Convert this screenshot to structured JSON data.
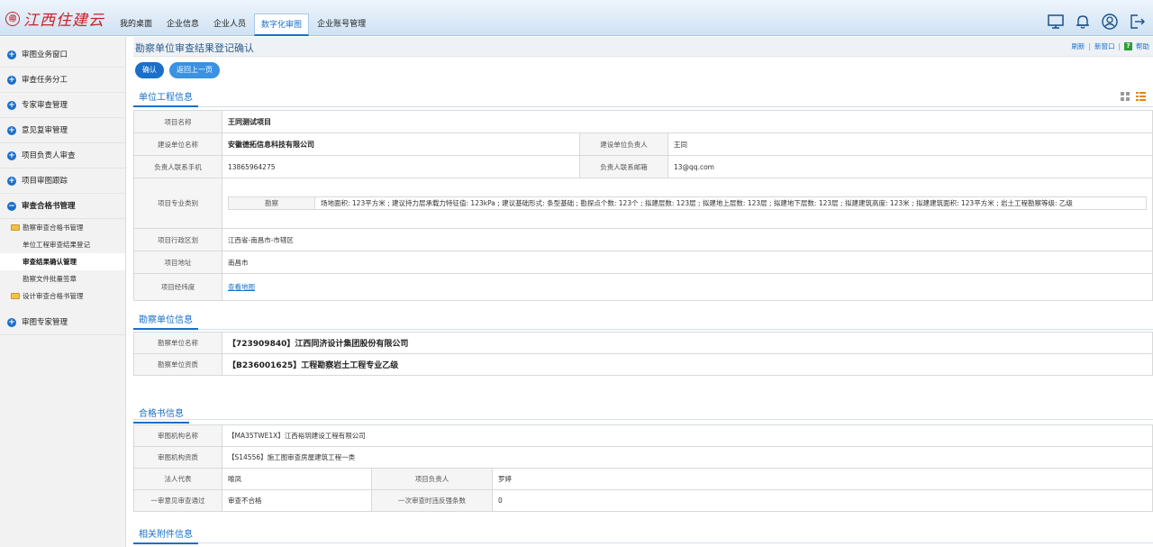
{
  "logo": {
    "seal": "㊞",
    "text": "江西住建云"
  },
  "nav": {
    "tabs": [
      {
        "label": "我的桌面"
      },
      {
        "label": "企业信息"
      },
      {
        "label": "企业人员"
      },
      {
        "label": "数字化审图",
        "active": true
      },
      {
        "label": "企业账号管理"
      }
    ]
  },
  "topicons": [
    "monitor-icon",
    "bell-icon",
    "user-icon",
    "logout-icon"
  ],
  "sidebar": {
    "items": [
      {
        "label": "审图业务窗口"
      },
      {
        "label": "审查任务分工"
      },
      {
        "label": "专家审查管理"
      },
      {
        "label": "意见复审管理"
      },
      {
        "label": "项目负责人审查"
      },
      {
        "label": "项目审图跟踪"
      },
      {
        "label": "审查合格书管理"
      },
      {
        "label": "审图专家管理"
      }
    ],
    "sub": {
      "folder1": "勘察审查合格书管理",
      "leaf1": "单位工程审查结果登记",
      "leaf2": "审查结果确认管理",
      "leaf3": "勘察文件批量签章",
      "folder2": "设计审查合格书管理"
    }
  },
  "page": {
    "title": "勘察单位审查结果登记确认",
    "links": {
      "refresh": "刷新",
      "sep": "|",
      "new_window": "新窗口",
      "help_q": "?",
      "help": "帮助"
    },
    "buttons": {
      "confirm": "确认",
      "back": "返回上一页"
    }
  },
  "project": {
    "section_title": "单位工程信息",
    "name_label": "项目名称",
    "name": "王同测试项目",
    "build_unit_label": "建设单位名称",
    "build_unit": "安徽德拓信息科技有限公司",
    "build_leader_label": "建设单位负责人",
    "build_leader": "王同",
    "phone_label": "负责人联系手机",
    "phone": "13865964275",
    "email_label": "负责人联系邮箱",
    "email": "13@qq.com",
    "category_label": "项目专业类别",
    "survey_label": "勘察",
    "survey_detail": "场地面积: 123平方米 ; 建议持力层承载力特征值: 123kPa ; 建议基础形式: 条型基础 ; 勘探点个数: 123个 ; 拟建层数: 123层 ; 拟建地上层数: 123层 ; 拟建地下层数: 123层 ; 拟建建筑高度: 123米 ; 拟建建筑面积: 123平方米 ; 岩土工程勘察等级: 乙级",
    "region_label": "项目行政区划",
    "region": "江西省-南昌市-市辖区",
    "address_label": "项目地址",
    "address": "南昌市",
    "geo_label": "项目经纬度",
    "geo_link": "查看地图"
  },
  "survey_unit": {
    "section_title": "勘察单位信息",
    "name_label": "勘察单位名称",
    "name": "【723909840】江西同济设计集团股份有限公司",
    "qual_label": "勘察单位资质",
    "qual": "【B236001625】工程勘察岩土工程专业乙级"
  },
  "certificate": {
    "section_title": "合格书信息",
    "org_label": "审图机构名称",
    "org": "【MA35TWE1X】江西裕玥建设工程有限公司",
    "org_qual_label": "审图机构资质",
    "org_qual": "【S14556】施工图审查房屋建筑工程一类",
    "legal_label": "法人代表",
    "legal": "喻凤",
    "leader_label": "项目负责人",
    "leader": "罗婷",
    "first_pass_label": "一审意见审查通过",
    "first_pass": "审查不合格",
    "violations_label": "一次审查时违反强条数",
    "violations": "0"
  },
  "attachments": {
    "section_title": "相关附件信息"
  },
  "colors": {
    "accent": "#1a6fc9",
    "logo": "#c8232c"
  }
}
